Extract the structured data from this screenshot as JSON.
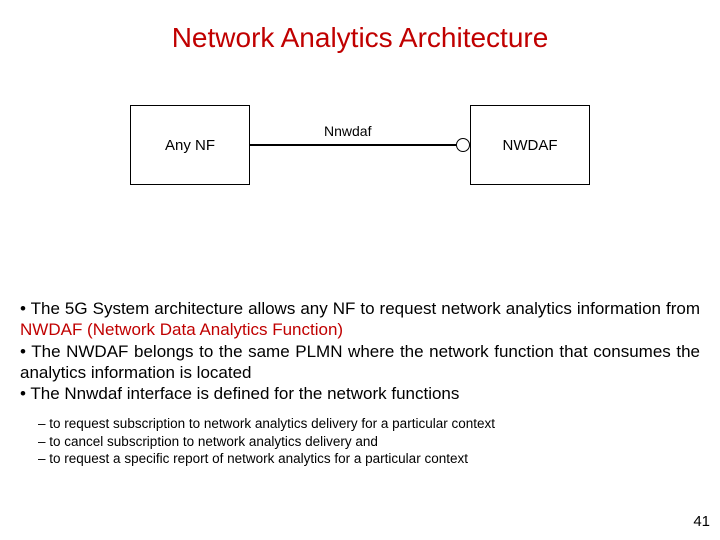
{
  "title": "Network Analytics Architecture",
  "diagram": {
    "left_box": "Any NF",
    "right_box": "NWDAF",
    "interface_label": "Nnwdaf"
  },
  "bullets": {
    "b1_pre": "The 5G System architecture allows any NF to request network analytics information from ",
    "b1_nwdaf": "NWDAF (Network Data Analytics Function)",
    "b2": "The NWDAF belongs to the same PLMN where the network function that consumes the analytics information is located",
    "b3": "The Nnwdaf interface is defined for the network functions"
  },
  "sub": {
    "s1": "to request subscription to network analytics delivery for a particular context",
    "s2": "to cancel subscription to network analytics delivery and",
    "s3": "to request a specific report of network analytics for a particular context"
  },
  "page_number": "41"
}
